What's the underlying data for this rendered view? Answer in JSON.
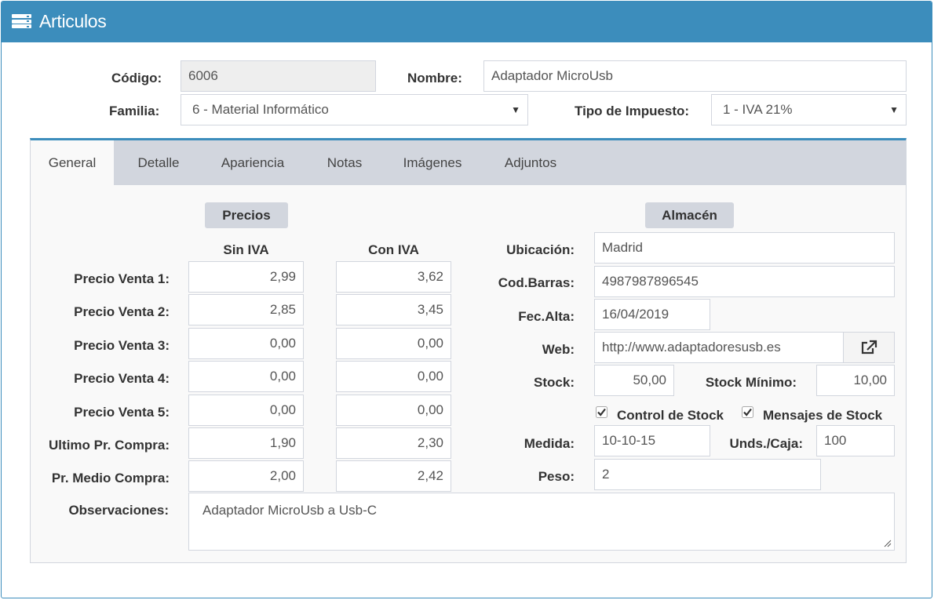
{
  "window": {
    "title": "Articulos"
  },
  "header": {
    "codigo_label": "Código:",
    "codigo_value": "6006",
    "nombre_label": "Nombre:",
    "nombre_value": "Adaptador MicroUsb",
    "familia_label": "Familia:",
    "familia_value": "6 - Material Informático",
    "impuesto_label": "Tipo de Impuesto:",
    "impuesto_value": "1 - IVA 21%"
  },
  "tabs": [
    {
      "label": "General"
    },
    {
      "label": "Detalle"
    },
    {
      "label": "Apariencia"
    },
    {
      "label": "Notas"
    },
    {
      "label": "Imágenes"
    },
    {
      "label": "Adjuntos"
    }
  ],
  "precios": {
    "section_label": "Precios",
    "col_sin": "Sin IVA",
    "col_con": "Con IVA",
    "rows": [
      {
        "label": "Precio Venta 1:",
        "sin": "2,99",
        "con": "3,62"
      },
      {
        "label": "Precio Venta 2:",
        "sin": "2,85",
        "con": "3,45"
      },
      {
        "label": "Precio Venta 3:",
        "sin": "0,00",
        "con": "0,00"
      },
      {
        "label": "Precio Venta 4:",
        "sin": "0,00",
        "con": "0,00"
      },
      {
        "label": "Precio Venta 5:",
        "sin": "0,00",
        "con": "0,00"
      },
      {
        "label": "Ultimo Pr. Compra:",
        "sin": "1,90",
        "con": "2,30"
      },
      {
        "label": "Pr. Medio Compra:",
        "sin": "2,00",
        "con": "2,42"
      }
    ]
  },
  "almacen": {
    "section_label": "Almacén",
    "ubicacion_label": "Ubicación:",
    "ubicacion_value": "Madrid",
    "codbarras_label": "Cod.Barras:",
    "codbarras_value": "4987987896545",
    "fecalta_label": "Fec.Alta:",
    "fecalta_value": "16/04/2019",
    "web_label": "Web:",
    "web_value": "http://www.adaptadoresusb.es",
    "stock_label": "Stock:",
    "stock_value": "50,00",
    "stockmin_label": "Stock Mínimo:",
    "stockmin_value": "10,00",
    "control_stock_label": "Control de Stock",
    "control_stock_checked": true,
    "mensajes_stock_label": "Mensajes de Stock",
    "mensajes_stock_checked": true,
    "medida_label": "Medida:",
    "medida_value": "10-10-15",
    "undscaja_label": "Unds./Caja:",
    "undscaja_value": "100",
    "peso_label": "Peso:",
    "peso_value": "2"
  },
  "observaciones": {
    "label": "Observaciones:",
    "value": "Adaptador MicroUsb a Usb-C"
  },
  "icons": {
    "title_icon": "server-icon",
    "web_icon": "external-link-icon"
  },
  "colors": {
    "accent": "#3c8dbc",
    "tabbar": "#d2d6de",
    "panel": "#f9f9f9"
  }
}
